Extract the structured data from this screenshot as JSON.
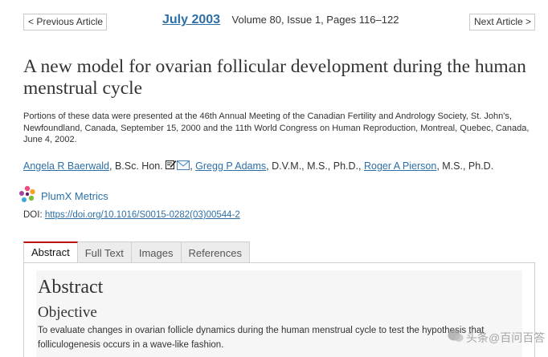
{
  "nav": {
    "prev_label": "< Previous Article",
    "next_label": "Next Article >"
  },
  "issue": {
    "date": "July 2003",
    "meta": "Volume 80, Issue 1, Pages 116–122"
  },
  "article": {
    "title": "A new model for ovarian follicular development during the human menstrual cycle",
    "note": "Portions of these data were presented at the 46th Annual Meeting of the Canadian Fertility and Andrology Society, St. John's, Newfoundland, Canada, September 15, 2000 and the 11th World Congress on Human Reproduction, Montreal, Quebec, Canada, June 4, 2002.",
    "authors": [
      {
        "name": "Angela R Baerwald",
        "credentials": ", B.Sc. Hon."
      },
      {
        "name": "Gregg P Adams",
        "credentials": ", D.V.M., M.S., Ph.D., "
      },
      {
        "name": "Roger A Pierson",
        "credentials": ", M.S., Ph.D."
      }
    ],
    "author_separator": ", ",
    "plumx_label": "PlumX Metrics",
    "doi_label": "DOI: ",
    "doi_link": "https://doi.org/10.1016/S0015-0282(03)00544-2"
  },
  "tabs": [
    {
      "label": "Abstract",
      "active": true
    },
    {
      "label": "Full Text",
      "active": false
    },
    {
      "label": "Images",
      "active": false
    },
    {
      "label": "References",
      "active": false
    }
  ],
  "abstract": {
    "heading": "Abstract",
    "subheading": "Objective",
    "text": "To evaluate changes in ovarian follicle dynamics during the human menstrual cycle to test the hypothesis that folliculogenesis occurs in a wave-like fashion."
  },
  "watermark": {
    "text": "头条@百问百答"
  },
  "colors": {
    "link": "#2c6fa6",
    "active_tab_border": "#b80f0f"
  }
}
